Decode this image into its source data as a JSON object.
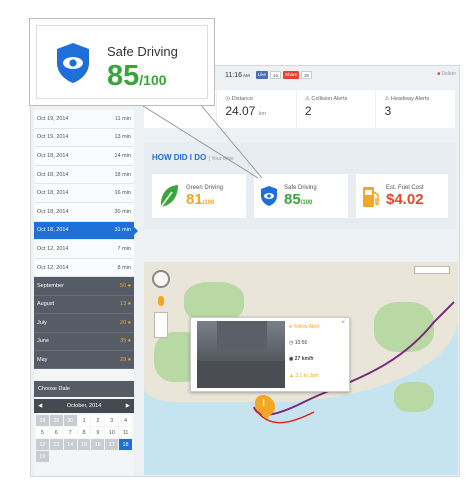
{
  "callout": {
    "title": "Safe Driving",
    "score": "85",
    "of": "/100"
  },
  "topbar": {
    "time": "11:16",
    "ampm": "AM",
    "like": "Like",
    "like_count": "16",
    "share": "Share",
    "share_count": "35",
    "delete": "Delete"
  },
  "stats": {
    "distance_label": "Distance",
    "distance_value": "24.07",
    "distance_unit": "km",
    "collision_label": "Collision Alerts",
    "collision_value": "2",
    "headway_label": "Headway Alerts",
    "headway_value": "3"
  },
  "how": {
    "title": "HOW DID I DO",
    "subtitle": "( Your drive",
    "green_label": "Green Driving",
    "green_score": "81",
    "green_of": "/100",
    "safe_label": "Safe Driving",
    "safe_score": "85",
    "safe_of": "/100",
    "fuel_label": "Est. Fuel Cost",
    "fuel_value": "$4.02"
  },
  "trips": [
    {
      "date": "Oct 19, 2014",
      "dur": "11 min"
    },
    {
      "date": "Oct 19, 2014",
      "dur": "13 min"
    },
    {
      "date": "Oct 18, 2014",
      "dur": "14 min"
    },
    {
      "date": "Oct 18, 2014",
      "dur": "18 min"
    },
    {
      "date": "Oct 18, 2014",
      "dur": "16 min"
    },
    {
      "date": "Oct 18, 2014",
      "dur": "30 min"
    },
    {
      "date": "Oct 18, 2014",
      "dur": "31 min"
    },
    {
      "date": "Oct 12, 2014",
      "dur": "7 min"
    },
    {
      "date": "Oct 12, 2014",
      "dur": "8 min"
    }
  ],
  "months": [
    {
      "name": "September",
      "count": "50"
    },
    {
      "name": "August",
      "count": "13"
    },
    {
      "name": "July",
      "count": "20"
    },
    {
      "name": "June",
      "count": "35"
    },
    {
      "name": "May",
      "count": "29"
    }
  ],
  "choose_date": "Choose Date",
  "calendar": {
    "month": "October, 2014"
  },
  "popup": {
    "place": "Yellow Alert",
    "time": "10:56",
    "speed": "27 km/h",
    "note": "3.1 to 3sm"
  },
  "colors": {
    "accent": "#1e6fd9",
    "green": "#3aa53a",
    "fuel": "#e8452c",
    "gold": "#f5a623"
  }
}
